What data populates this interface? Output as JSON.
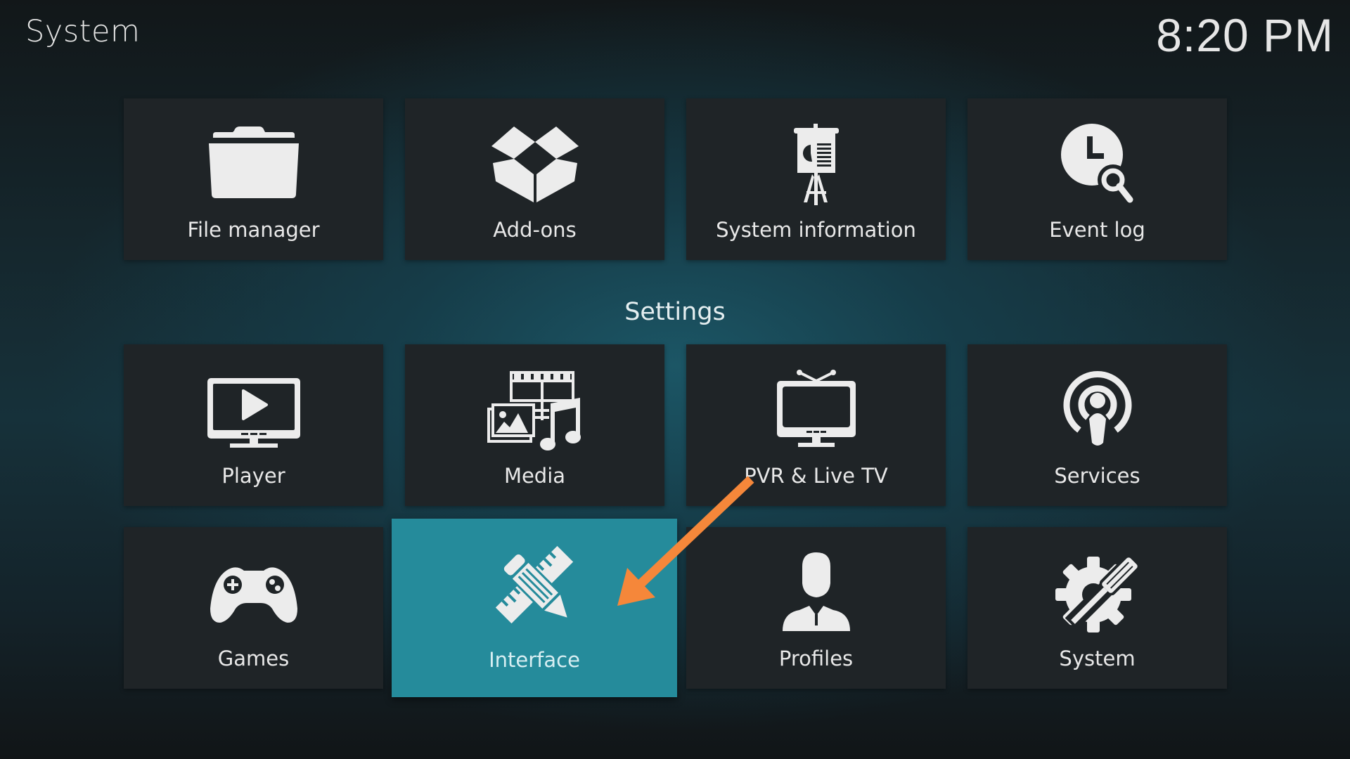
{
  "header": {
    "title": "System",
    "clock": "8:20 PM"
  },
  "top_row": [
    {
      "id": "file-manager",
      "label": "File manager",
      "icon": "folder-icon"
    },
    {
      "id": "add-ons",
      "label": "Add-ons",
      "icon": "open-box-icon"
    },
    {
      "id": "system-information",
      "label": "System information",
      "icon": "presentation-easel-icon"
    },
    {
      "id": "event-log",
      "label": "Event log",
      "icon": "clock-search-icon"
    }
  ],
  "settings": {
    "title": "Settings",
    "items": [
      {
        "id": "player",
        "label": "Player",
        "icon": "monitor-play-icon"
      },
      {
        "id": "media",
        "label": "Media",
        "icon": "media-film-photo-music-icon"
      },
      {
        "id": "pvr-live-tv",
        "label": "PVR & Live TV",
        "icon": "tv-antenna-icon"
      },
      {
        "id": "services",
        "label": "Services",
        "icon": "broadcast-person-icon"
      },
      {
        "id": "games",
        "label": "Games",
        "icon": "gamepad-icon"
      },
      {
        "id": "interface",
        "label": "Interface",
        "icon": "pencil-ruler-icon",
        "focused": true
      },
      {
        "id": "profiles",
        "label": "Profiles",
        "icon": "user-silhouette-icon"
      },
      {
        "id": "system",
        "label": "System",
        "icon": "gear-screwdriver-icon"
      }
    ]
  },
  "annotation": {
    "type": "arrow",
    "points_to": "interface",
    "color": "#f5873a"
  },
  "colors": {
    "tile_bg": "#1f2427",
    "tile_focused_bg": "#258b9b",
    "text": "#e8e8e8"
  }
}
